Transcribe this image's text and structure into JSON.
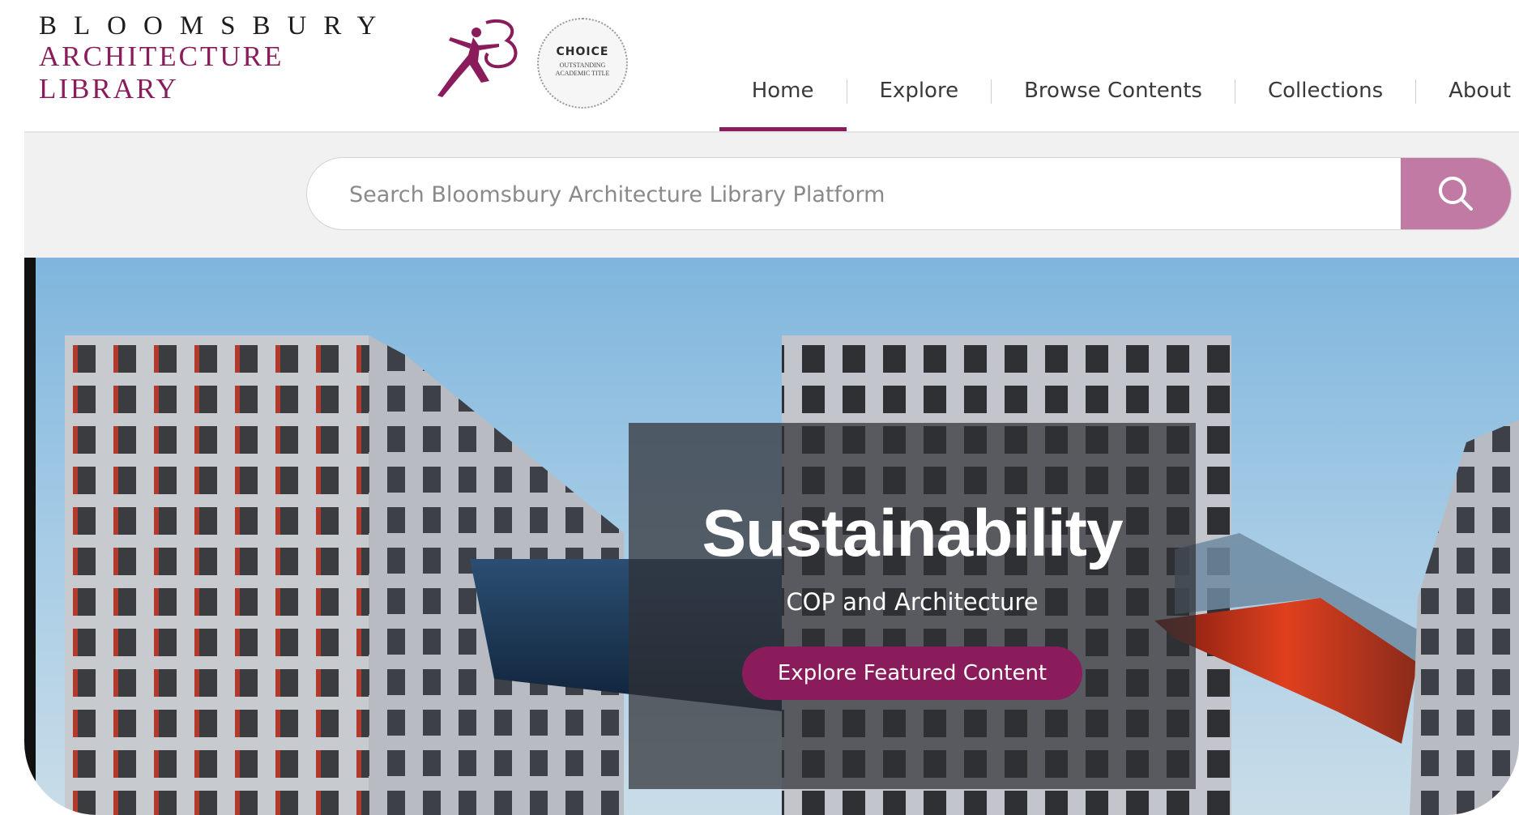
{
  "brand": {
    "line1": "BLOOMSBURY",
    "line2": "ARCHITECTURE",
    "line3": "LIBRARY",
    "badge_title": "CHOICE",
    "badge_sub1": "OUTSTANDING",
    "badge_sub2": "ACADEMIC TITLE",
    "accent_color": "#8a1c5c"
  },
  "nav": {
    "items": [
      {
        "label": "Home",
        "active": true
      },
      {
        "label": "Explore"
      },
      {
        "label": "Browse Contents"
      },
      {
        "label": "Collections"
      },
      {
        "label": "About"
      }
    ]
  },
  "search": {
    "placeholder": "Search Bloomsbury Architecture Library Platform",
    "icon": "search-icon",
    "button_color": "#c07aa4"
  },
  "hero": {
    "title": "Sustainability",
    "subtitle": "COP and Architecture",
    "cta_label": "Explore Featured Content"
  }
}
